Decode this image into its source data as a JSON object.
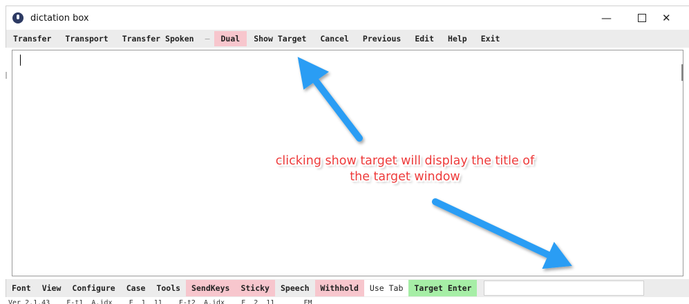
{
  "window": {
    "title": "dictation box",
    "icon": "microphone-app-icon",
    "controls": {
      "minimize": "—",
      "maximize": "",
      "close": "✕"
    }
  },
  "menubar": {
    "items": [
      {
        "label": "Transfer"
      },
      {
        "label": "Transport"
      },
      {
        "label": "Transfer Spoken"
      },
      {
        "label": "—"
      },
      {
        "label": "Dual",
        "highlight": "#f7c6cd"
      },
      {
        "label": "Show Target"
      },
      {
        "label": "Cancel"
      },
      {
        "label": "Previous"
      },
      {
        "label": "Edit"
      },
      {
        "label": "Help"
      },
      {
        "label": "Exit"
      }
    ]
  },
  "editor": {
    "value": ""
  },
  "annotation": {
    "line1": "clicking show target will display the title of",
    "line2": "the target window",
    "text_color": "#ee3b3b",
    "arrow_color": "#2a9df4"
  },
  "bottombar": {
    "items": [
      {
        "label": "Font"
      },
      {
        "label": "View"
      },
      {
        "label": "Configure"
      },
      {
        "label": "Case"
      },
      {
        "label": "Tools"
      },
      {
        "label": "SendKeys",
        "highlight": "#f7c6cd"
      },
      {
        "label": "Sticky",
        "highlight": "#f7c6cd"
      },
      {
        "label": "Speech"
      },
      {
        "label": "Withhold",
        "highlight": "#f7c6cd"
      },
      {
        "label": "Use Tab",
        "highlight": "#ffffff"
      },
      {
        "label": "Target Enter",
        "highlight": "#a6eea6"
      }
    ],
    "input_value": ""
  },
  "status": {
    "text": "Ver 2.1.43    F-t1  A.idx    F  1  11    F-t2  A.idx    F  2  11       FM"
  }
}
